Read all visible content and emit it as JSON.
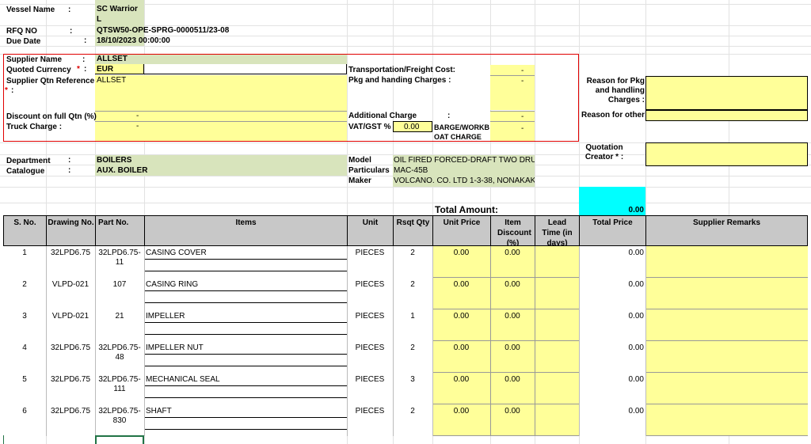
{
  "vessel": {
    "label": "Vessel Name",
    "colon": ":",
    "value": "SC Warrior",
    "value2": "L"
  },
  "rfq": {
    "label": "RFQ NO",
    "colon": ":",
    "value": "QTSW50-OPE-SPRG-0000511/23-08"
  },
  "due": {
    "label": "Due Date",
    "colon": ":",
    "value": "18/10/2023 00:00:00"
  },
  "supplier": {
    "name_label": "Supplier Name",
    "name_colon": ":",
    "name_value": "ALLSET",
    "currency_label": "Quoted Currency",
    "currency_star": "*",
    "currency_colon": ":",
    "currency_value": "EUR",
    "qtn_label": "Supplier Qtn Reference",
    "qtn_star": "*",
    "qtn_colon": ":",
    "qtn_value": "ALLSET",
    "discount_label": "Discount on full Qtn  (%)",
    "discount_value": "-",
    "truck_label": "Truck Charge :",
    "truck_value": "-",
    "transport_label": "Transportation/Freight Cost:",
    "transport_value": "-",
    "pkg_label": "Pkg and handing Charges  :",
    "pkg_value": "-",
    "additional_label": "Additional Charge",
    "additional_colon": ":",
    "additional_value": "-",
    "vat_label": "VAT/GST %",
    "vat_value": "0.00",
    "barge_label": "BARGE/WORKB",
    "barge_label2": "OAT CHARGE",
    "barge_value": "-",
    "reason_pkg_label": "Reason for Pkg and handling Charges :",
    "reason_other_label": "Reason for other"
  },
  "department": {
    "label": "Department",
    "colon": ":",
    "value": "BOILERS"
  },
  "catalogue": {
    "label": "Catalogue",
    "colon": ":",
    "value": "AUX. BOILER"
  },
  "model": {
    "label": "Model",
    "value": "OIL FIRED FORCED-DRAFT TWO DRU"
  },
  "particulars": {
    "label": "Particulars",
    "value": "MAC-45B"
  },
  "maker": {
    "label": "Maker",
    "value": "VOLCANO. CO. LTD 1-3-38, NONAKAKI"
  },
  "quotation_creator_label": "Quotation Creator * :",
  "total": {
    "label": "Total Amount:",
    "value": "0.00"
  },
  "headers": [
    "S. No.",
    "Drawing No.",
    "Part No.",
    "Items",
    "Unit",
    "Rsqt Qty",
    "Unit Price",
    "Item Discount (%)",
    "Lead Time (in days)",
    "Total Price",
    "Supplier Remarks"
  ],
  "rows": [
    {
      "sno": "1",
      "drawing": "32LPD6.75",
      "part": "32LPD6.75-",
      "part2": "11",
      "item": "CASING COVER",
      "unit": "PIECES",
      "qty": "2",
      "price": "0.00",
      "discount": "0.00",
      "total": "0.00"
    },
    {
      "sno": "2",
      "drawing": "VLPD-021",
      "part": "107",
      "part2": "",
      "item": "CASING RING",
      "unit": "PIECES",
      "qty": "2",
      "price": "0.00",
      "discount": "0.00",
      "total": "0.00"
    },
    {
      "sno": "3",
      "drawing": "VLPD-021",
      "part": "21",
      "part2": "",
      "item": "IMPELLER",
      "unit": "PIECES",
      "qty": "1",
      "price": "0.00",
      "discount": "0.00",
      "total": "0.00"
    },
    {
      "sno": "4",
      "drawing": "32LPD6.75",
      "part": "32LPD6.75-",
      "part2": "48",
      "item": "IMPELLER NUT",
      "unit": "PIECES",
      "qty": "2",
      "price": "0.00",
      "discount": "0.00",
      "total": "0.00"
    },
    {
      "sno": "5",
      "drawing": "32LPD6.75",
      "part": "32LPD6.75-",
      "part2": "111",
      "item": "MECHANICAL SEAL",
      "unit": "PIECES",
      "qty": "3",
      "price": "0.00",
      "discount": "0.00",
      "total": "0.00"
    },
    {
      "sno": "6",
      "drawing": "32LPD6.75",
      "part": "32LPD6.75-",
      "part2": "830",
      "item": "SHAFT",
      "unit": "PIECES",
      "qty": "2",
      "price": "0.00",
      "discount": "0.00",
      "total": "0.00"
    }
  ]
}
